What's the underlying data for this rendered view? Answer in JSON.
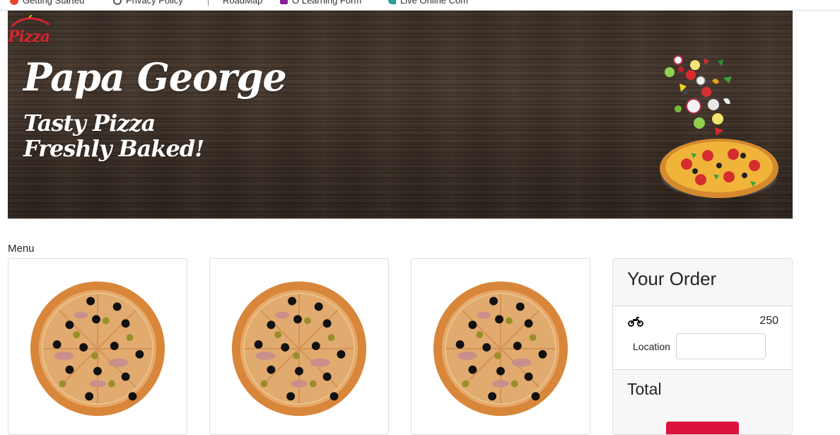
{
  "bookmarks": [
    {
      "label": "Getting Started",
      "icon": "firefox-icon",
      "color": "#e8452c"
    },
    {
      "label": "Privacy Policy",
      "icon": "globe-icon",
      "color": "#555555"
    },
    {
      "label": "RoadMap",
      "icon": "",
      "color": ""
    },
    {
      "label": "O Learning Form",
      "icon": "form-icon",
      "color": "#8b1a9c"
    },
    {
      "label": "Live Online Com",
      "icon": "leaf-icon",
      "color": "#2aa198"
    }
  ],
  "hero": {
    "logo_text": "Pizza",
    "title": "Papa George",
    "subtitle_line1": "Tasty Pizza",
    "subtitle_line2": "Freshly Baked!"
  },
  "menu": {
    "heading": "Menu",
    "items": [
      {
        "image": "seafood-pizza-image"
      },
      {
        "image": "seafood-pizza-image"
      },
      {
        "image": "seafood-pizza-image"
      }
    ]
  },
  "order": {
    "title": "Your Order",
    "delivery_icon": "motorcycle-icon",
    "delivery_price": "250",
    "location_label": "Location",
    "location_value": "",
    "total_label": "Total",
    "checkout_label": ""
  },
  "colors": {
    "accent": "#dc143c",
    "panel_bg": "#f7f7f7",
    "wood": "#3e3229"
  }
}
